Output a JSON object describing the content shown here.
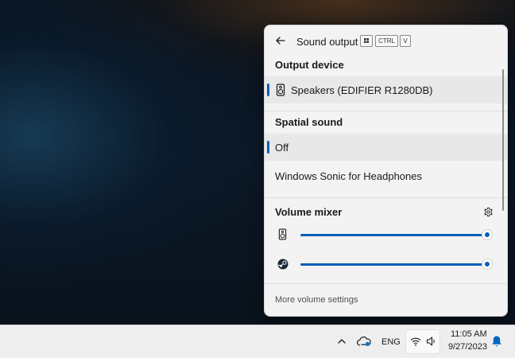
{
  "flyout": {
    "title": "Sound output",
    "shortcut": {
      "ctrl": "CTRL",
      "v": "V"
    },
    "output_device": {
      "heading": "Output device",
      "devices": [
        {
          "label": "Speakers (EDIFIER R1280DB)",
          "icon": "speaker-icon",
          "selected": true
        }
      ]
    },
    "spatial_sound": {
      "heading": "Spatial sound",
      "options": [
        {
          "label": "Off",
          "selected": true
        },
        {
          "label": "Windows Sonic for Headphones",
          "selected": false
        }
      ]
    },
    "volume_mixer": {
      "heading": "Volume mixer",
      "items": [
        {
          "app_icon": "speaker-icon",
          "level": 1.0
        },
        {
          "app_icon": "steam-icon",
          "level": 1.0
        }
      ]
    },
    "footer_link": "More volume settings"
  },
  "taskbar": {
    "language": "ENG",
    "time": "11:05 AM",
    "date": "9/27/2023"
  },
  "colors": {
    "accent": "#005fb8",
    "flyout_bg": "#f3f3f3",
    "selected_row": "#e8e8e8"
  }
}
